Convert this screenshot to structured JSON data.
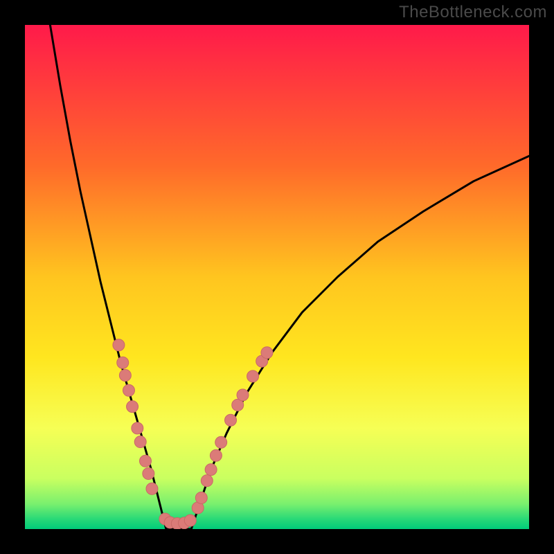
{
  "watermark": "TheBottleneck.com",
  "colors": {
    "bg_black": "#000000",
    "grad_top": "#ff1a4a",
    "grad_mid_upper": "#ff8a1f",
    "grad_mid": "#ffe11f",
    "grad_mid_lower": "#f8ff5a",
    "grad_low1": "#aaff66",
    "grad_low2": "#33e077",
    "grad_low3": "#00cc7a",
    "curve": "#000000",
    "dot_fill": "#db7b78",
    "dot_stroke": "#c96a66"
  },
  "chart_data": {
    "type": "line",
    "title": "",
    "xlabel": "",
    "ylabel": "",
    "xlim": [
      0,
      100
    ],
    "ylim": [
      0,
      100
    ],
    "grid": false,
    "series": [
      {
        "name": "curve-left",
        "x": [
          5,
          7,
          9,
          11,
          13,
          15,
          17,
          19,
          21,
          23,
          25,
          26,
          27,
          28
        ],
        "y": [
          100,
          88,
          77,
          67,
          58,
          49,
          41,
          33,
          26,
          19,
          12,
          8,
          4,
          0
        ]
      },
      {
        "name": "curve-right",
        "x": [
          33,
          35,
          37,
          40,
          44,
          49,
          55,
          62,
          70,
          79,
          89,
          100
        ],
        "y": [
          0,
          6,
          12,
          19,
          27,
          35,
          43,
          50,
          57,
          63,
          69,
          74
        ]
      },
      {
        "name": "valley-flat",
        "x": [
          28,
          29,
          30,
          31,
          32,
          33
        ],
        "y": [
          0,
          0,
          0,
          0,
          0,
          0
        ]
      }
    ],
    "scatter": [
      {
        "name": "dots-left",
        "points": [
          [
            18.6,
            36.5
          ],
          [
            19.4,
            33.0
          ],
          [
            19.9,
            30.5
          ],
          [
            20.6,
            27.5
          ],
          [
            21.3,
            24.3
          ],
          [
            22.3,
            20.0
          ],
          [
            22.9,
            17.3
          ],
          [
            23.9,
            13.5
          ],
          [
            24.5,
            11.0
          ],
          [
            25.2,
            8.0
          ]
        ]
      },
      {
        "name": "dots-right",
        "points": [
          [
            34.3,
            4.2
          ],
          [
            35.0,
            6.2
          ],
          [
            36.1,
            9.6
          ],
          [
            36.9,
            11.8
          ],
          [
            37.9,
            14.6
          ],
          [
            38.9,
            17.2
          ],
          [
            40.8,
            21.6
          ],
          [
            42.2,
            24.6
          ],
          [
            43.2,
            26.6
          ],
          [
            45.2,
            30.3
          ],
          [
            47.0,
            33.3
          ],
          [
            48.0,
            35.0
          ]
        ]
      },
      {
        "name": "dots-valley",
        "points": [
          [
            27.8,
            2.0
          ],
          [
            28.8,
            1.3
          ],
          [
            30.2,
            1.1
          ],
          [
            31.6,
            1.2
          ],
          [
            32.8,
            1.7
          ]
        ]
      }
    ]
  }
}
